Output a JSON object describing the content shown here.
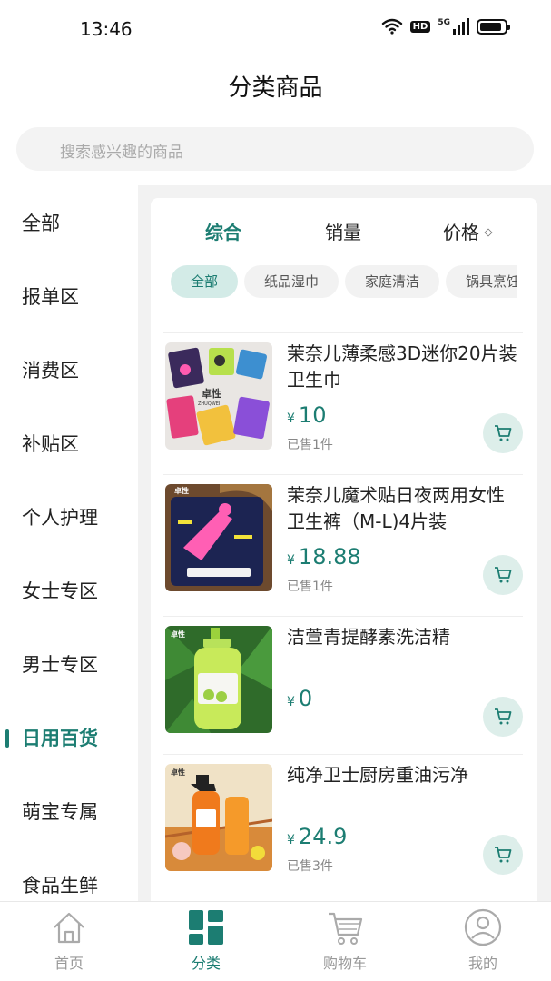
{
  "status_bar": {
    "time": "13:46",
    "hd": "HD",
    "network": "5G"
  },
  "header": {
    "title": "分类商品"
  },
  "search": {
    "placeholder": "搜索感兴趣的商品"
  },
  "sidebar": {
    "items": [
      {
        "label": "全部"
      },
      {
        "label": "报单区"
      },
      {
        "label": "消费区"
      },
      {
        "label": "补贴区"
      },
      {
        "label": "个人护理"
      },
      {
        "label": "女士专区"
      },
      {
        "label": "男士专区"
      },
      {
        "label": "日用百货",
        "active": true
      },
      {
        "label": "萌宝专属"
      },
      {
        "label": "食品生鲜"
      }
    ]
  },
  "sort_tabs": [
    {
      "label": "综合",
      "active": true
    },
    {
      "label": "销量"
    },
    {
      "label": "价格"
    }
  ],
  "chips": [
    {
      "label": "全部",
      "active": true
    },
    {
      "label": "纸品湿巾"
    },
    {
      "label": "家庭清洁"
    },
    {
      "label": "锅具烹饪"
    }
  ],
  "products": [
    {
      "name": "茉奈儿薄柔感3D迷你20片装卫生巾",
      "currency": "¥",
      "price": "10",
      "sold": "已售1件"
    },
    {
      "name": "茉奈儿魔术贴日夜两用女性卫生裤（M-L)4片装",
      "currency": "¥",
      "price": "18.88",
      "sold": "已售1件"
    },
    {
      "name": "洁萱青提酵素洗洁精",
      "currency": "¥",
      "price": "0",
      "sold": ""
    },
    {
      "name": "纯净卫士厨房重油污净",
      "currency": "¥",
      "price": "24.9",
      "sold": "已售3件"
    }
  ],
  "thumb_labels": {
    "brand_zh": "卓性",
    "brand_en": "ZHUQWEI"
  },
  "tabbar": {
    "items": [
      {
        "label": "首页",
        "icon": "home-icon"
      },
      {
        "label": "分类",
        "icon": "category-icon",
        "active": true
      },
      {
        "label": "购物车",
        "icon": "cart-icon"
      },
      {
        "label": "我的",
        "icon": "profile-icon"
      }
    ]
  },
  "colors": {
    "accent": "#1c7d72",
    "accent_light": "#d3ebe7",
    "background": "#f2f2f2"
  }
}
